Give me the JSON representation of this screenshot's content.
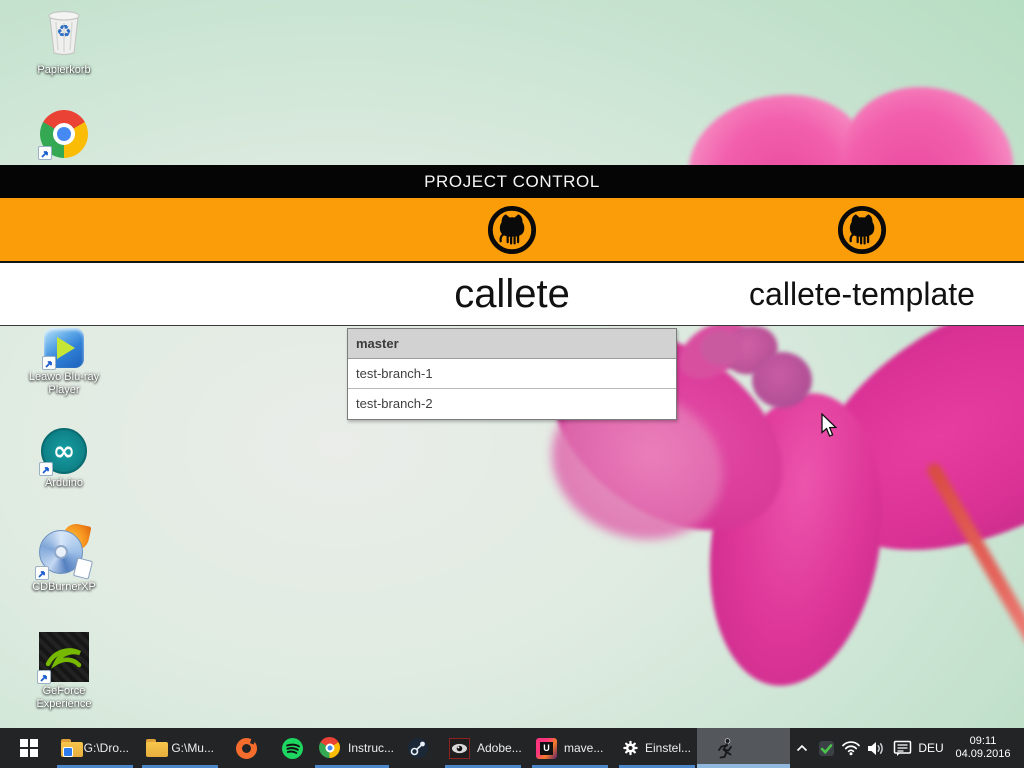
{
  "project_control": {
    "title": "PROJECT CONTROL",
    "repos": [
      {
        "name": "callete"
      },
      {
        "name": "callete-template"
      }
    ],
    "branch_list": {
      "selected": "master",
      "items": [
        "master",
        "test-branch-1",
        "test-branch-2"
      ]
    }
  },
  "desktop": {
    "icons": [
      {
        "id": "recycle-bin",
        "label": "Papierkorb"
      },
      {
        "id": "chrome-shortcut",
        "label": ""
      },
      {
        "id": "leawo",
        "label": "Leawo Blu-ray Player"
      },
      {
        "id": "arduino",
        "label": "Arduino"
      },
      {
        "id": "cdburnerxp",
        "label": "CDBurnerXP"
      },
      {
        "id": "geforce",
        "label": "GeForce Experience"
      }
    ]
  },
  "taskbar": {
    "items": [
      {
        "label": "G:\\Dro...",
        "icon": "explorer-folder-dropbox",
        "open": true
      },
      {
        "label": "G:\\Mu...",
        "icon": "explorer-folder",
        "open": true
      },
      {
        "label": "",
        "icon": "origin",
        "open": false
      },
      {
        "label": "",
        "icon": "spotify",
        "open": false
      },
      {
        "label": "Instruc...",
        "icon": "chrome",
        "open": true
      },
      {
        "label": "",
        "icon": "steam",
        "open": false
      },
      {
        "label": "Adobe...",
        "icon": "adobe",
        "open": true
      },
      {
        "label": "mave...",
        "icon": "intellij-maven",
        "open": true
      },
      {
        "label": "Einstel...",
        "icon": "settings-gear",
        "open": true
      },
      {
        "label": "",
        "icon": "java-runner",
        "open": true,
        "active": true
      }
    ],
    "tray": {
      "language": "DEU",
      "time": "09:11",
      "date": "04.09.2016"
    }
  },
  "colors": {
    "accent_orange": "#FB9D08",
    "header_black": "#050505",
    "taskbar_underline_blue": "#4B86C8",
    "flower_pink": "#D6309A"
  }
}
